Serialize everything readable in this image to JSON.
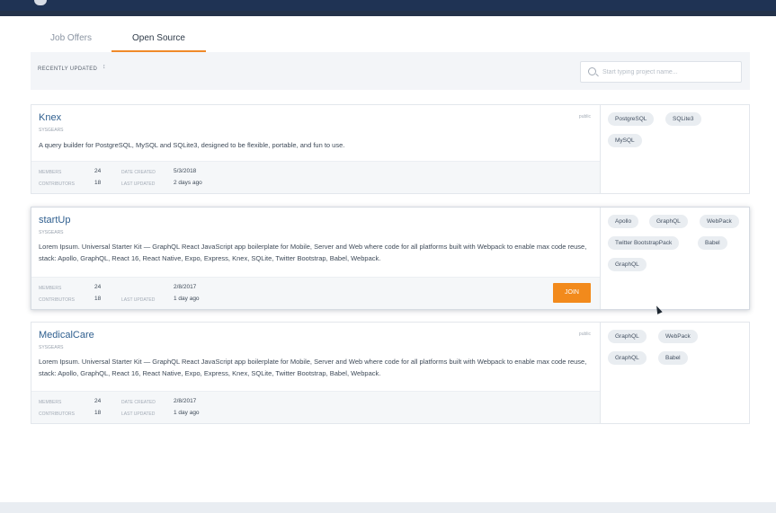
{
  "tabs": [
    {
      "label": "Job Offers",
      "active": false
    },
    {
      "label": "Open Source",
      "active": true
    }
  ],
  "filter": {
    "sort_label": "RECENTLY UPDATED",
    "sort_caret": "↕",
    "search_placeholder": "Start typing project name..."
  },
  "projects": [
    {
      "title": "Knex",
      "org": "SYSGEARS",
      "visibility": "public",
      "description": "A query builder for PostgreSQL, MySQL and SQLite3, designed to be flexible, portable, and fun to use.",
      "members_label": "MEMBERS",
      "members": "24",
      "contributors_label": "CONTRIBUTORS",
      "contributors": "18",
      "date_created_label": "DATE CREATED",
      "date_created": "5/3/2018",
      "last_updated_label": "LAST UPDATED",
      "last_updated": "2 days ago",
      "tags": [
        "PostgreSQL",
        "SQLite3",
        "MySQL"
      ]
    },
    {
      "title": "startUp",
      "org": "SYSGEARS",
      "description": "Lorem Ipsum. Universal Starter Kit — GraphQL React JavaScript app boilerplate for Mobile, Server and Web where code for all platforms built with Webpack to enable max code reuse, stack: Apollo, GraphQL, React 16, React Native, Expo, Express, Knex, SQLite, Twitter Bootstrap, Babel, Webpack.",
      "members_label": "MEMBERS",
      "members": "24",
      "contributors_label": "CONTRIBUTORS",
      "contributors": "18",
      "date_created": "2/8/2017",
      "last_updated_label": "LAST UPDATED",
      "last_updated": "1 day ago",
      "join_label": "JOIN",
      "tags": [
        "Apollo",
        "GraphQL",
        "WebPack",
        "Twitter BootstrapPack",
        "Babel",
        "GraphQL"
      ]
    },
    {
      "title": "MedicalCare",
      "org": "SYSGEARS",
      "visibility": "public",
      "description": "Lorem Ipsum. Universal Starter Kit — GraphQL React JavaScript app boilerplate for Mobile, Server and Web where code for all platforms built with Webpack to enable max code reuse, stack: Apollo, GraphQL, React 16, React Native, Expo, Express, Knex, SQLite, Twitter Bootstrap, Babel, Webpack.",
      "members_label": "MEMBERS",
      "members": "24",
      "contributors_label": "CONTRIBUTORS",
      "contributors": "18",
      "date_created_label": "DATE CREATED",
      "date_created": "2/8/2017",
      "last_updated_label": "LAST UPDATED",
      "last_updated": "1 day ago",
      "tags": [
        "GraphQL",
        "WebPack",
        "GraphQL",
        "Babel"
      ]
    }
  ],
  "colors": {
    "accent": "#f28a1c",
    "link": "#2f5f8f",
    "header": "#1f3354"
  }
}
